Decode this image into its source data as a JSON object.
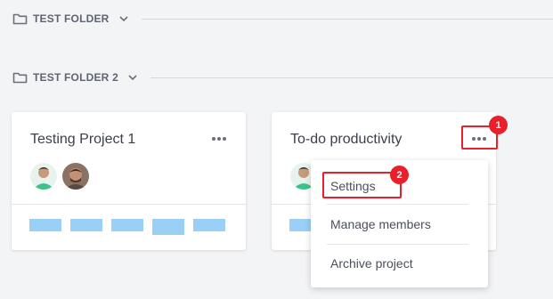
{
  "folders": [
    {
      "label": "TEST FOLDER"
    },
    {
      "label": "TEST FOLDER 2"
    }
  ],
  "projects": [
    {
      "title": "Testing Project 1"
    },
    {
      "title": "To-do productivity"
    }
  ],
  "menu": {
    "items": [
      {
        "label": "Settings"
      },
      {
        "label": "Manage members"
      },
      {
        "label": "Archive project"
      }
    ]
  },
  "callouts": {
    "first": "1",
    "second": "2"
  },
  "colors": {
    "accent_red": "#e8202c",
    "bar_blue": "#9ad0f5",
    "avatar_green": "#3cc38a"
  }
}
